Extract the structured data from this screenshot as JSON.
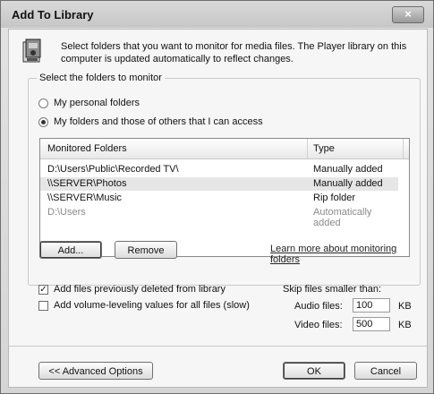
{
  "window": {
    "title": "Add To Library",
    "close_label": "×"
  },
  "header": {
    "description": "Select folders that you want to monitor for media files. The Player library on this computer is updated automatically to reflect changes."
  },
  "monitor_group": {
    "label": "Select the folders to monitor",
    "options": [
      {
        "label": "My personal folders",
        "selected": false
      },
      {
        "label": "My folders and those of others that I can access",
        "selected": true
      }
    ]
  },
  "folders_table": {
    "columns": [
      "Monitored Folders",
      "Type"
    ],
    "rows": [
      {
        "folder": "D:\\Users\\Public\\Recorded TV\\",
        "type": "Manually added"
      },
      {
        "folder": "\\\\SERVER\\Photos",
        "type": "Manually added"
      },
      {
        "folder": "\\\\SERVER\\Music",
        "type": "Rip folder"
      },
      {
        "folder": "D:\\Users",
        "type": "Automatically added"
      }
    ]
  },
  "buttons": {
    "add": "Add...",
    "remove": "Remove",
    "learn_more": "Learn more about monitoring folders",
    "advanced": "<< Advanced Options",
    "ok": "OK",
    "cancel": "Cancel"
  },
  "options": {
    "add_deleted": {
      "label": "Add files previously deleted from library",
      "checked": true
    },
    "volume_leveling": {
      "label": "Add volume-leveling values for all files (slow)",
      "checked": false
    }
  },
  "skip": {
    "title": "Skip files smaller than:",
    "audio_label": "Audio files:",
    "audio_value": "100",
    "audio_unit": "KB",
    "video_label": "Video files:",
    "video_value": "500",
    "video_unit": "KB"
  }
}
